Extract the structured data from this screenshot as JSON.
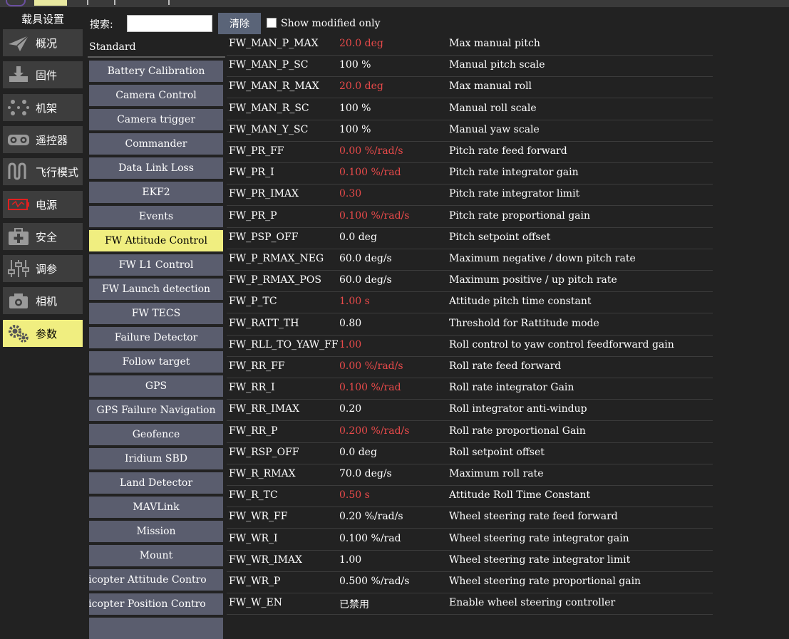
{
  "vehicle_setup_title": "载具设置",
  "nav": [
    {
      "label": "概况",
      "icon": "plane-icon",
      "active": false
    },
    {
      "label": "固件",
      "icon": "download-icon",
      "active": false
    },
    {
      "label": "机架",
      "icon": "airframe-icon",
      "active": false
    },
    {
      "label": "遥控器",
      "icon": "radio-controller-icon",
      "active": false
    },
    {
      "label": "飞行模式",
      "icon": "flight-modes-icon",
      "active": false
    },
    {
      "label": "电源",
      "icon": "battery-icon",
      "active": false
    },
    {
      "label": "安全",
      "icon": "safety-icon",
      "active": false
    },
    {
      "label": "调参",
      "icon": "tuning-sliders-icon",
      "active": false
    },
    {
      "label": "相机",
      "icon": "camera-icon",
      "active": false
    },
    {
      "label": "参数",
      "icon": "gears-icon",
      "active": true
    }
  ],
  "search": {
    "label": "搜索:",
    "value": "",
    "placeholder": ""
  },
  "clear_label": "清除",
  "show_modified_label": "Show modified only",
  "show_modified_checked": false,
  "group_title": "Standard",
  "groups": [
    {
      "label": "Battery Calibration",
      "active": false
    },
    {
      "label": "Camera Control",
      "active": false
    },
    {
      "label": "Camera trigger",
      "active": false
    },
    {
      "label": "Commander",
      "active": false
    },
    {
      "label": "Data Link Loss",
      "active": false
    },
    {
      "label": "EKF2",
      "active": false
    },
    {
      "label": "Events",
      "active": false
    },
    {
      "label": "FW Attitude Control",
      "active": true
    },
    {
      "label": "FW L1 Control",
      "active": false
    },
    {
      "label": "FW Launch detection",
      "active": false
    },
    {
      "label": "FW TECS",
      "active": false
    },
    {
      "label": "Failure Detector",
      "active": false
    },
    {
      "label": "Follow target",
      "active": false
    },
    {
      "label": "GPS",
      "active": false
    },
    {
      "label": "GPS Failure Navigation",
      "active": false
    },
    {
      "label": "Geofence",
      "active": false
    },
    {
      "label": "Iridium SBD",
      "active": false
    },
    {
      "label": "Land Detector",
      "active": false
    },
    {
      "label": "MAVLink",
      "active": false
    },
    {
      "label": "Mission",
      "active": false
    },
    {
      "label": "Mount",
      "active": false
    },
    {
      "label": "ulticopter Attitude Contro",
      "active": false,
      "clipped": true
    },
    {
      "label": "ulticopter Position Contro",
      "active": false,
      "clipped": true
    }
  ],
  "modified_color": "#e84a4a",
  "params": [
    {
      "name": "FW_MAN_P_MAX",
      "value": "20.0 deg",
      "modified": true,
      "desc": "Max manual pitch"
    },
    {
      "name": "FW_MAN_P_SC",
      "value": "100 %",
      "modified": false,
      "desc": "Manual pitch scale"
    },
    {
      "name": "FW_MAN_R_MAX",
      "value": "20.0 deg",
      "modified": true,
      "desc": "Max manual roll"
    },
    {
      "name": "FW_MAN_R_SC",
      "value": "100 %",
      "modified": false,
      "desc": "Manual roll scale"
    },
    {
      "name": "FW_MAN_Y_SC",
      "value": "100 %",
      "modified": false,
      "desc": "Manual yaw scale"
    },
    {
      "name": "FW_PR_FF",
      "value": "0.00 %/rad/s",
      "modified": true,
      "desc": "Pitch rate feed forward"
    },
    {
      "name": "FW_PR_I",
      "value": "0.100 %/rad",
      "modified": true,
      "desc": "Pitch rate integrator gain"
    },
    {
      "name": "FW_PR_IMAX",
      "value": "0.30",
      "modified": true,
      "desc": "Pitch rate integrator limit"
    },
    {
      "name": "FW_PR_P",
      "value": "0.100 %/rad/s",
      "modified": true,
      "desc": "Pitch rate proportional gain"
    },
    {
      "name": "FW_PSP_OFF",
      "value": "0.0 deg",
      "modified": false,
      "desc": "Pitch setpoint offset"
    },
    {
      "name": "FW_P_RMAX_NEG",
      "value": "60.0 deg/s",
      "modified": false,
      "desc": "Maximum negative / down pitch rate"
    },
    {
      "name": "FW_P_RMAX_POS",
      "value": "60.0 deg/s",
      "modified": false,
      "desc": "Maximum positive / up pitch rate"
    },
    {
      "name": "FW_P_TC",
      "value": "1.00 s",
      "modified": true,
      "desc": "Attitude pitch time constant"
    },
    {
      "name": "FW_RATT_TH",
      "value": "0.80",
      "modified": false,
      "desc": "Threshold for Rattitude mode"
    },
    {
      "name": "FW_RLL_TO_YAW_FF",
      "value": "1.00",
      "modified": true,
      "desc": "Roll control to yaw control feedforward gain"
    },
    {
      "name": "FW_RR_FF",
      "value": "0.00 %/rad/s",
      "modified": true,
      "desc": "Roll rate feed forward"
    },
    {
      "name": "FW_RR_I",
      "value": "0.100 %/rad",
      "modified": true,
      "desc": "Roll rate integrator Gain"
    },
    {
      "name": "FW_RR_IMAX",
      "value": "0.20",
      "modified": false,
      "desc": "Roll integrator anti-windup"
    },
    {
      "name": "FW_RR_P",
      "value": "0.200 %/rad/s",
      "modified": true,
      "desc": "Roll rate proportional Gain"
    },
    {
      "name": "FW_RSP_OFF",
      "value": "0.0 deg",
      "modified": false,
      "desc": "Roll setpoint offset"
    },
    {
      "name": "FW_R_RMAX",
      "value": "70.0 deg/s",
      "modified": false,
      "desc": "Maximum roll rate"
    },
    {
      "name": "FW_R_TC",
      "value": "0.50 s",
      "modified": true,
      "desc": "Attitude Roll Time Constant"
    },
    {
      "name": "FW_WR_FF",
      "value": "0.20 %/rad/s",
      "modified": false,
      "desc": "Wheel steering rate feed forward"
    },
    {
      "name": "FW_WR_I",
      "value": "0.100 %/rad",
      "modified": false,
      "desc": "Wheel steering rate integrator gain"
    },
    {
      "name": "FW_WR_IMAX",
      "value": "1.00",
      "modified": false,
      "desc": "Wheel steering rate integrator limit"
    },
    {
      "name": "FW_WR_P",
      "value": "0.500 %/rad/s",
      "modified": false,
      "desc": "Wheel steering rate proportional gain"
    },
    {
      "name": "FW_W_EN",
      "value": "已禁用",
      "modified": false,
      "desc": "Enable wheel steering controller"
    }
  ]
}
